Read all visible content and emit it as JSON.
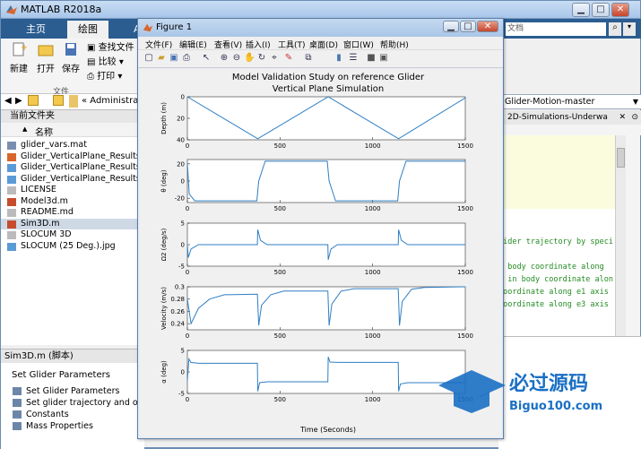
{
  "app": {
    "title": "MATLAB R2018a",
    "colors": {
      "titlebar": "#a8c6ea",
      "ribbon_tab_bar": "#2b5d91",
      "plot_line": "#2f7ec4"
    }
  },
  "tabs": [
    "主页",
    "绘图",
    "A"
  ],
  "ribbon": {
    "new_label": "新建",
    "open_label": "打开",
    "save_label": "保存",
    "find_files": "查找文件",
    "compare": "比较",
    "print": "打印",
    "group_label": "文件"
  },
  "address": {
    "path": "« Administrato"
  },
  "current_folder": {
    "header": "当前文件夹",
    "column_name": "名称",
    "files": [
      {
        "name": "glider_vars.mat",
        "icon": "mat-file-icon",
        "selected": false
      },
      {
        "name": "Glider_VerticalPlane_Results.f",
        "icon": "figure-file-icon",
        "selected": false
      },
      {
        "name": "Glider_VerticalPlane_Results.j",
        "icon": "image-file-icon",
        "selected": false
      },
      {
        "name": "Glider_VerticalPlane_Results.j",
        "icon": "image-file-icon",
        "selected": false
      },
      {
        "name": "LICENSE",
        "icon": "text-file-icon",
        "selected": false
      },
      {
        "name": "Model3d.m",
        "icon": "m-file-icon",
        "selected": false
      },
      {
        "name": "README.md",
        "icon": "text-file-icon",
        "selected": false
      },
      {
        "name": "Sim3D.m",
        "icon": "m-file-icon",
        "selected": true
      },
      {
        "name": "SLOCUM 3D",
        "icon": "text-file-icon",
        "selected": false
      },
      {
        "name": "SLOCUM (25 Deg.).jpg",
        "icon": "image-file-icon",
        "selected": false
      }
    ]
  },
  "details": {
    "header": "Sim3D.m  (脚本)",
    "title": "Set Glider Parameters",
    "items": [
      "Set Glider Parameters",
      "Set glider trajectory and ot...",
      "Constants",
      "Mass Properties"
    ]
  },
  "right_panel": {
    "search_placeholder": "文档",
    "folder": "Glider-Motion-master",
    "editor_tab": "2D-Simulations-Underwa",
    "code_lines": [
      "lider trajectory by speci",
      "n body coordinate along",
      "l in body coordinate alon",
      " coordinate along e1 axis",
      " coordinate along e3 axis"
    ]
  },
  "figure": {
    "window_title": "Figure 1",
    "menu": [
      "文件(F)",
      "编辑(E)",
      "查看(V)",
      "插入(I)",
      "工具(T)",
      "桌面(D)",
      "窗口(W)",
      "帮助(H)"
    ],
    "plot_title_line1": "Model Validation Study on reference Glider",
    "plot_title_line2": "Vertical Plane Simulation",
    "xlabel": "Time (Seconds)"
  },
  "chart_data": [
    {
      "type": "line",
      "ylabel": "Depth (m)",
      "xlim": [
        0,
        1500
      ],
      "ylim": [
        40,
        0
      ],
      "xticks": [
        0,
        500,
        1000,
        1500
      ],
      "yticks": [
        0,
        20,
        40
      ],
      "x": [
        0,
        380,
        760,
        1140,
        1500
      ],
      "y": [
        0,
        39,
        0,
        39,
        1
      ]
    },
    {
      "type": "line",
      "ylabel": "θ (deg)",
      "xlim": [
        0,
        1500
      ],
      "ylim": [
        -25,
        25
      ],
      "xticks": [
        0,
        500,
        1000,
        1500
      ],
      "yticks": [
        -20,
        0,
        20
      ],
      "x": [
        0,
        10,
        40,
        375,
        385,
        420,
        755,
        765,
        800,
        1135,
        1145,
        1180,
        1500
      ],
      "y": [
        20,
        -15,
        -23,
        -23,
        0,
        23,
        23,
        0,
        -23,
        -23,
        0,
        23,
        23
      ]
    },
    {
      "type": "line",
      "ylabel": "Ω2 (deg/s)",
      "xlim": [
        0,
        1500
      ],
      "ylim": [
        -5,
        5
      ],
      "xticks": [
        0,
        500,
        1000,
        1500
      ],
      "yticks": [
        -5,
        0,
        5
      ],
      "x": [
        0,
        5,
        20,
        60,
        378,
        380,
        395,
        430,
        758,
        760,
        775,
        810,
        1138,
        1140,
        1155,
        1190,
        1500
      ],
      "y": [
        0,
        -3,
        -1,
        0,
        0,
        3.5,
        1,
        0,
        0,
        -3.5,
        -1,
        0,
        0,
        3.5,
        1,
        0,
        0
      ]
    },
    {
      "type": "line",
      "ylabel": "Velocity (m/s)",
      "xlim": [
        0,
        1500
      ],
      "ylim": [
        0.23,
        0.3
      ],
      "xticks": [
        0,
        500,
        1000,
        1500
      ],
      "yticks": [
        0.24,
        0.26,
        0.28,
        0.3
      ],
      "x": [
        0,
        20,
        60,
        120,
        200,
        378,
        385,
        400,
        450,
        520,
        758,
        765,
        780,
        830,
        900,
        1138,
        1145,
        1160,
        1210,
        1280,
        1500
      ],
      "y": [
        0.28,
        0.24,
        0.265,
        0.28,
        0.287,
        0.288,
        0.237,
        0.27,
        0.287,
        0.293,
        0.293,
        0.237,
        0.272,
        0.293,
        0.297,
        0.297,
        0.237,
        0.276,
        0.296,
        0.299,
        0.3
      ]
    },
    {
      "type": "line",
      "ylabel": "α (deg)",
      "xlim": [
        0,
        1500
      ],
      "ylim": [
        -5,
        5
      ],
      "xticks": [
        0,
        500,
        1000,
        1500
      ],
      "yticks": [
        -5,
        0,
        5
      ],
      "x": [
        0,
        8,
        20,
        60,
        378,
        380,
        390,
        430,
        758,
        760,
        770,
        810,
        1138,
        1140,
        1150,
        1190,
        1500
      ],
      "y": [
        -2,
        3,
        2.2,
        2.0,
        2.0,
        -4.5,
        -2.5,
        -2.3,
        -2.3,
        3.5,
        2.3,
        2.2,
        2.2,
        -4.5,
        -2.8,
        -2.5,
        -2.5
      ]
    }
  ],
  "watermark": {
    "text_cn": "必过源码",
    "text_url": "Biguo100.com"
  }
}
